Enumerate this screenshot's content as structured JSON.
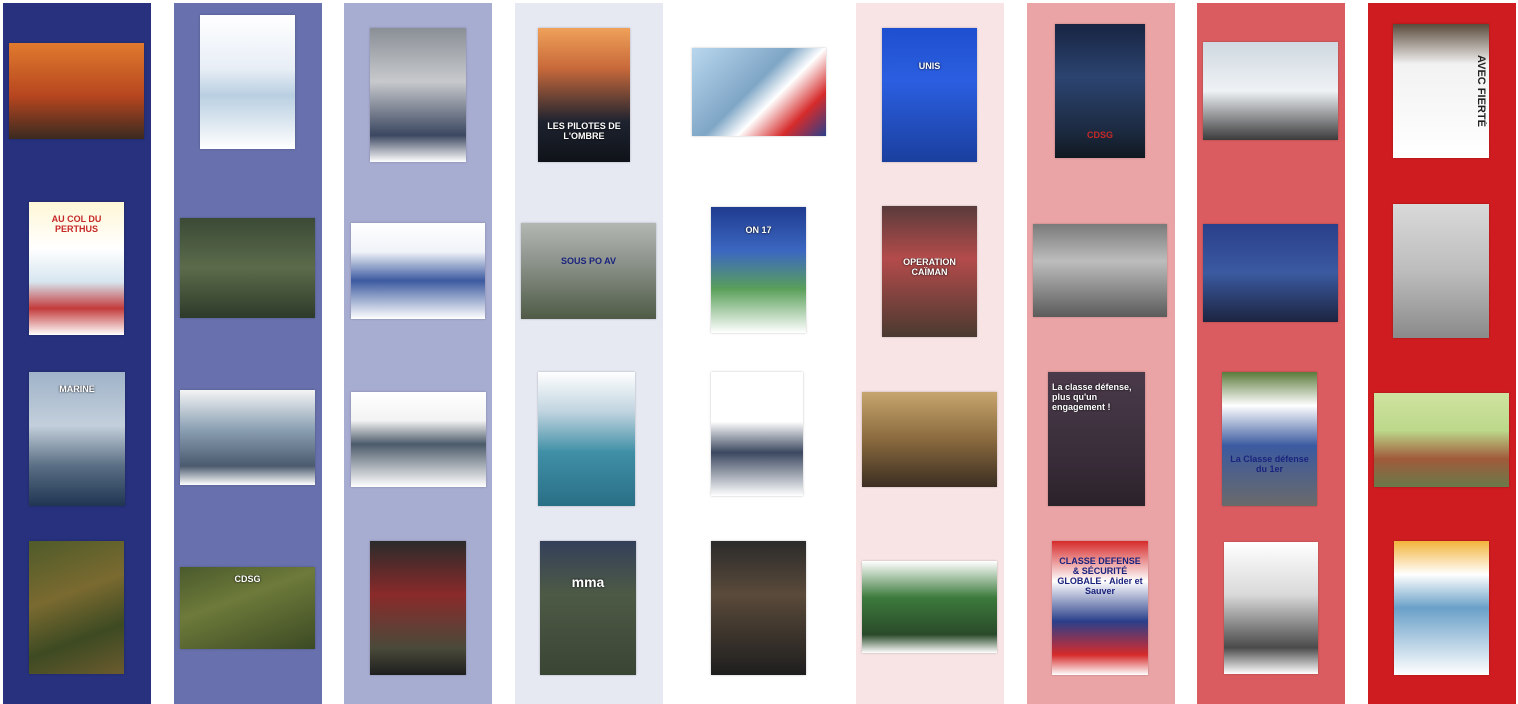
{
  "columns": [
    {
      "color": "#27317d"
    },
    {
      "color": "#6871ad"
    },
    {
      "color": "#a7acd1"
    },
    {
      "color": "#e6e8f2"
    },
    {
      "color": "#ffffff"
    },
    {
      "color": "#f8e4e5"
    },
    {
      "color": "#eba4a6"
    },
    {
      "color": "#db5c60"
    },
    {
      "color": "#cf1c20"
    }
  ],
  "cards": [
    {
      "caption": ""
    },
    {
      "caption": "AU COL DU PERTHUS"
    },
    {
      "caption": "MARINE"
    },
    {
      "caption": ""
    },
    {
      "caption": ""
    },
    {
      "caption": ""
    },
    {
      "caption": ""
    },
    {
      "caption": "CDSG"
    },
    {
      "caption": ""
    },
    {
      "caption": ""
    },
    {
      "caption": ""
    },
    {
      "caption": ""
    },
    {
      "caption": "LES PILOTES DE L'OMBRE"
    },
    {
      "caption": "SOUS PO AV"
    },
    {
      "caption": ""
    },
    {
      "caption": "mma"
    },
    {
      "caption": ""
    },
    {
      "caption": "ON 17"
    },
    {
      "caption": ""
    },
    {
      "caption": ""
    },
    {
      "caption": "UNIS"
    },
    {
      "caption": "OPÉRATION CAÏMAN"
    },
    {
      "caption": ""
    },
    {
      "caption": ""
    },
    {
      "caption": "CDSG"
    },
    {
      "caption": ""
    },
    {
      "caption": "La classe défense, plus qu'un engagement !"
    },
    {
      "caption": "CLASSE DÉFENSE & SÉCURITÉ GLOBALE · Aider et Sauver"
    },
    {
      "caption": ""
    },
    {
      "caption": ""
    },
    {
      "caption": "La Classe défense du 1er"
    },
    {
      "caption": ""
    },
    {
      "caption": "AVEC FIERTÉ"
    },
    {
      "caption": ""
    },
    {
      "caption": ""
    },
    {
      "caption": ""
    }
  ]
}
